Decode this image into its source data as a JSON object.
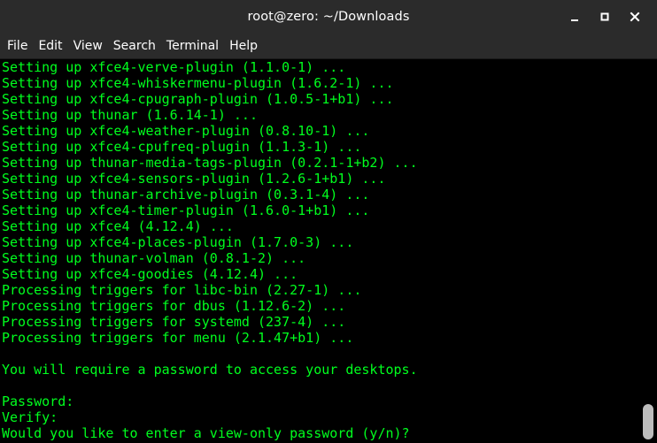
{
  "window": {
    "title": "root@zero: ~/Downloads",
    "controls": {
      "minimize_icon": "minimize-icon",
      "maximize_icon": "maximize-icon",
      "close_icon": "close-icon"
    }
  },
  "menubar": {
    "items": [
      "File",
      "Edit",
      "View",
      "Search",
      "Terminal",
      "Help"
    ]
  },
  "terminal": {
    "foreground": "#00ff1e",
    "background": "#000000",
    "lines": [
      "Setting up xfce4-verve-plugin (1.1.0-1) ...",
      "Setting up xfce4-whiskermenu-plugin (1.6.2-1) ...",
      "Setting up xfce4-cpugraph-plugin (1.0.5-1+b1) ...",
      "Setting up thunar (1.6.14-1) ...",
      "Setting up xfce4-weather-plugin (0.8.10-1) ...",
      "Setting up xfce4-cpufreq-plugin (1.1.3-1) ...",
      "Setting up thunar-media-tags-plugin (0.2.1-1+b2) ...",
      "Setting up xfce4-sensors-plugin (1.2.6-1+b1) ...",
      "Setting up thunar-archive-plugin (0.3.1-4) ...",
      "Setting up xfce4-timer-plugin (1.6.0-1+b1) ...",
      "Setting up xfce4 (4.12.4) ...",
      "Setting up xfce4-places-plugin (1.7.0-3) ...",
      "Setting up thunar-volman (0.8.1-2) ...",
      "Setting up xfce4-goodies (4.12.4) ...",
      "Processing triggers for libc-bin (2.27-1) ...",
      "Processing triggers for dbus (1.12.6-2) ...",
      "Processing triggers for systemd (237-4) ...",
      "Processing triggers for menu (2.1.47+b1) ...",
      "",
      "You will require a password to access your desktops.",
      "",
      "Password:",
      "Verify:",
      "Would you like to enter a view-only password (y/n)?"
    ]
  }
}
